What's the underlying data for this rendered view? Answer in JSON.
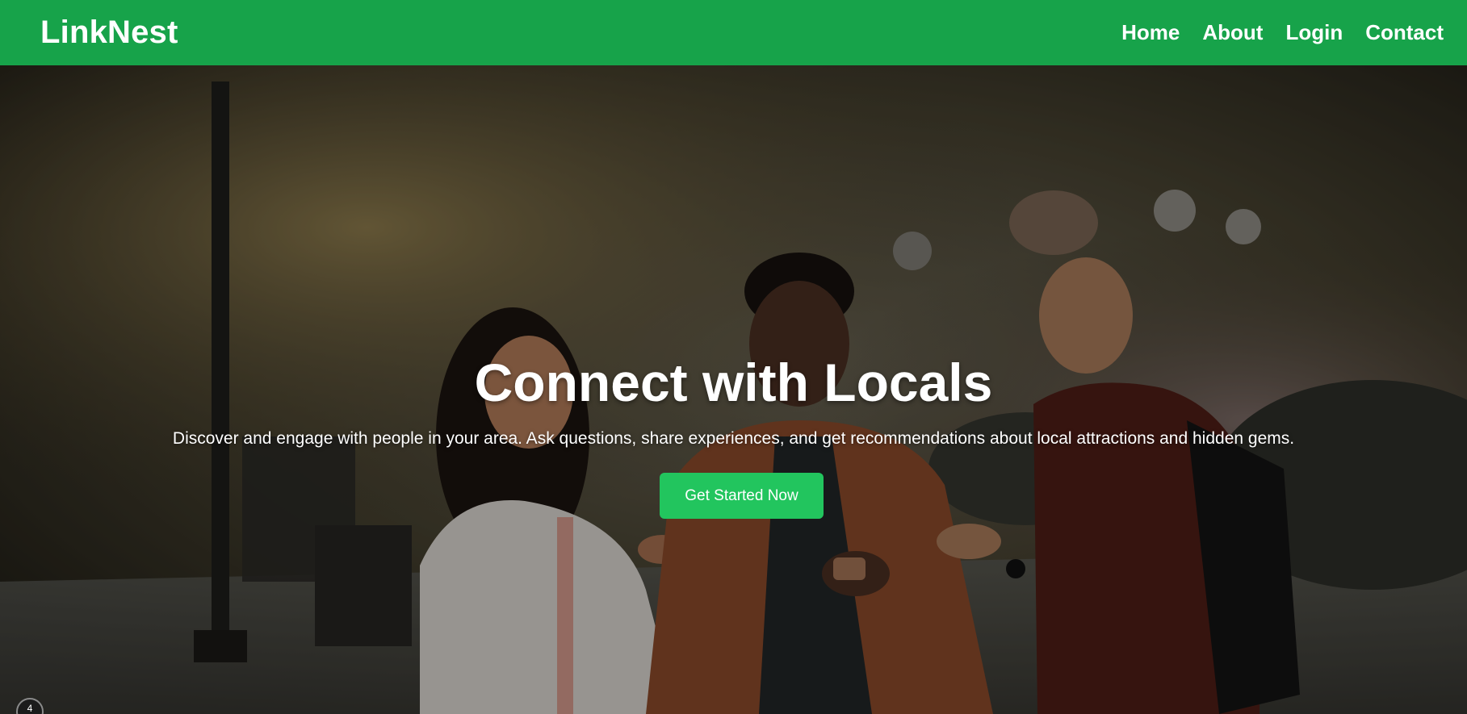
{
  "nav": {
    "brand": "LinkNest",
    "links": [
      "Home",
      "About",
      "Login",
      "Contact"
    ]
  },
  "hero": {
    "title": "Connect with Locals",
    "subtitle": "Discover and engage with people in your area. Ask questions, share experiences, and get recommendations about local attractions and hidden gems.",
    "cta_label": "Get Started Now",
    "image_description_icon": "photo-of-three-people-using-phones-in-park"
  },
  "badge": {
    "text": "4"
  },
  "colors": {
    "navbar": "#17a34a",
    "cta": "#22c55e",
    "text": "#ffffff"
  }
}
